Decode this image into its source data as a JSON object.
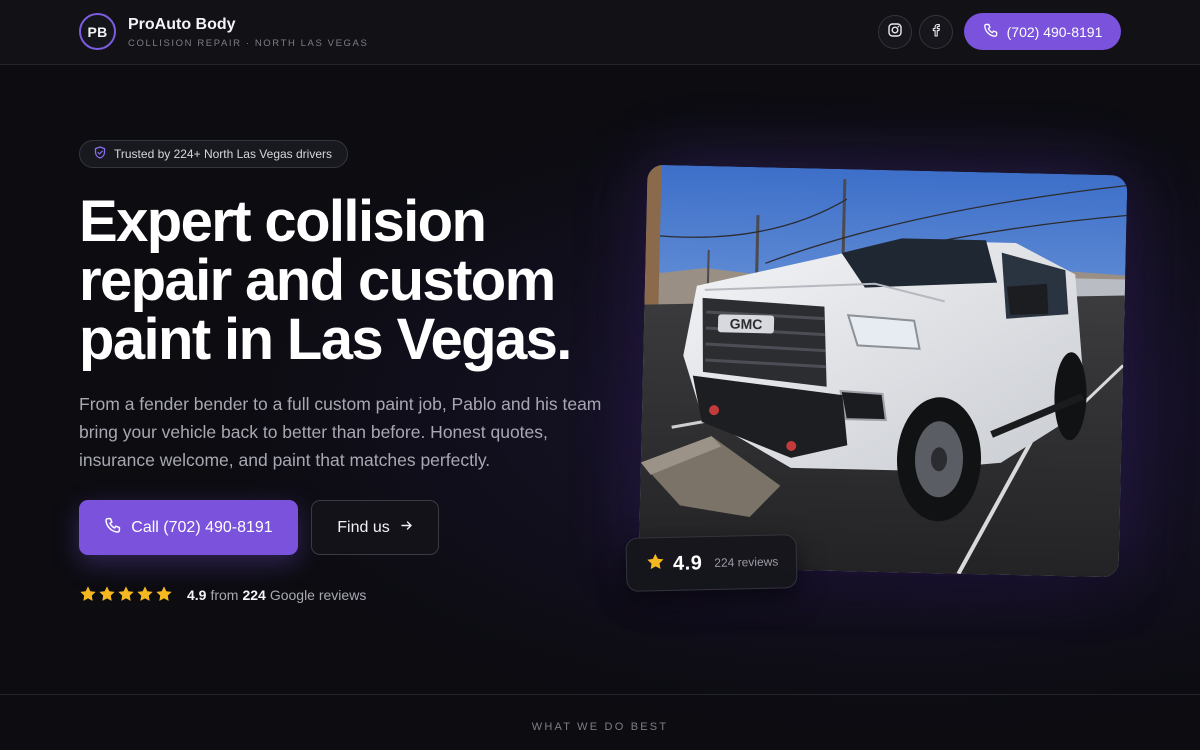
{
  "header": {
    "logo_initials": "PB",
    "brand_name": "ProAuto Body",
    "brand_tagline": "COLLISION REPAIR · NORTH LAS VEGAS",
    "social": [
      {
        "icon": "instagram-icon"
      },
      {
        "icon": "facebook-icon"
      }
    ],
    "call_label": "(702) 490-8191"
  },
  "hero": {
    "trust_badge": "Trusted by 224+ North Las Vegas drivers",
    "title": "Expert collision repair and custom paint in Las Vegas.",
    "subtitle": "From a fender bender to a full custom paint job, Pablo and his team bring your vehicle back to better than before. Honest quotes, insurance welcome, and paint that matches perfectly.",
    "primary_cta": "Call (702) 490-8191",
    "secondary_cta": "Find us",
    "rating": {
      "stars": 5,
      "score": "4.9",
      "from_text": "from",
      "count": "224",
      "source_text": "Google reviews"
    },
    "photo_card": {
      "score": "4.9",
      "reviews_text": "224 reviews"
    },
    "photo_badge_text": "GMC"
  },
  "section": {
    "label": "WHAT WE DO BEST"
  },
  "colors": {
    "accent": "#7a52db",
    "background": "#0c0c11",
    "star": "#f5b821"
  }
}
